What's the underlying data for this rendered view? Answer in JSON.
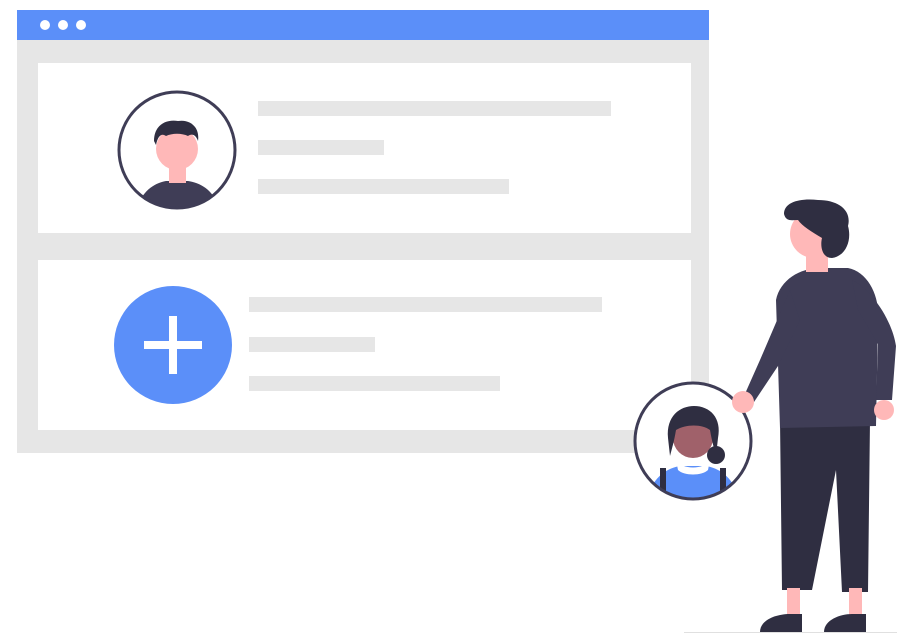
{
  "window": {
    "controls": [
      "window-dot",
      "window-dot",
      "window-dot"
    ]
  },
  "profile_cards": [
    {
      "avatar": "male-user-avatar",
      "text_lines": 3
    },
    {
      "action": "add-user",
      "icon": "plus-icon",
      "text_lines": 3
    }
  ],
  "floating_avatar": "female-user-avatar",
  "colors": {
    "accent": "#5b8ff9",
    "panel": "#e6e6e6",
    "dark": "#3f3d56",
    "skin": "#ffb8b8",
    "hair": "#2f2e41"
  }
}
